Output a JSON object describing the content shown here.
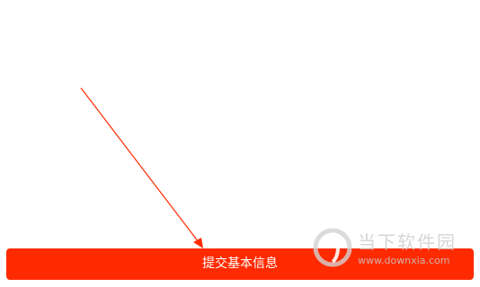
{
  "submit_button": {
    "label": "提交基本信息",
    "color": "#ff2a00",
    "text_color": "#ffffff"
  },
  "annotation": {
    "color": "#ff2a00"
  },
  "watermark": {
    "title": "当下软件园",
    "url": "www.downxia.com"
  }
}
